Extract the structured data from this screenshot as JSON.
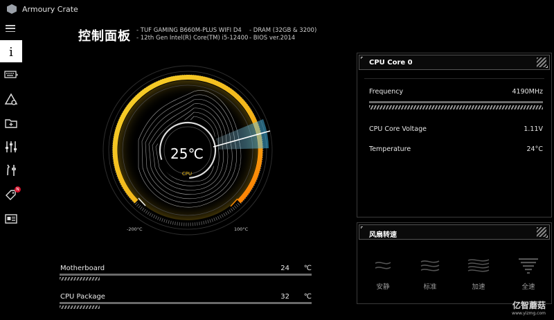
{
  "app": {
    "title": "Armoury Crate"
  },
  "header": {
    "title": "控制面板",
    "specs": [
      "-  TUF GAMING B660M-PLUS WIFI D4",
      "-  12th Gen Intel(R) Core(TM) i5-12400",
      "-  DRAM (32GB & 3200)",
      "-  BIOS ver.2014"
    ]
  },
  "sidebar": {
    "items": [
      {
        "name": "info",
        "icon": "info-icon",
        "active": true
      },
      {
        "name": "devices",
        "icon": "keyboard-icon"
      },
      {
        "name": "aura",
        "icon": "triangle-icon"
      },
      {
        "name": "gamevisual",
        "icon": "folder-plus-icon"
      },
      {
        "name": "settings-sliders",
        "icon": "sliders-icon"
      },
      {
        "name": "tools",
        "icon": "tools-icon"
      },
      {
        "name": "deals",
        "icon": "tag-icon",
        "badge": "N"
      },
      {
        "name": "news",
        "icon": "news-icon"
      }
    ]
  },
  "gauge": {
    "temperature": "25℃",
    "label": "CPU",
    "min_label": "-200°C",
    "max_label": "100°C",
    "colors": {
      "warm": "#f2c21b",
      "hot": "#ff7a00",
      "cool": "#3cb7e8"
    }
  },
  "temps": [
    {
      "name": "Motherboard",
      "value": "24",
      "unit": "℃"
    },
    {
      "name": "CPU Package",
      "value": "32",
      "unit": "℃"
    }
  ],
  "cpu_panel": {
    "title": "CPU Core 0",
    "rows": [
      {
        "label": "Frequency",
        "value": "4190MHz"
      },
      {
        "label": "CPU Core Voltage",
        "value": "1.11V"
      },
      {
        "label": "Temperature",
        "value": "24°C"
      }
    ]
  },
  "fan_panel": {
    "title": "风扇转速",
    "modes": [
      "安静",
      "标准",
      "加速",
      "全速"
    ]
  },
  "watermark": {
    "line1": "亿智蘑菇",
    "line2": "www.yizmg.com"
  }
}
